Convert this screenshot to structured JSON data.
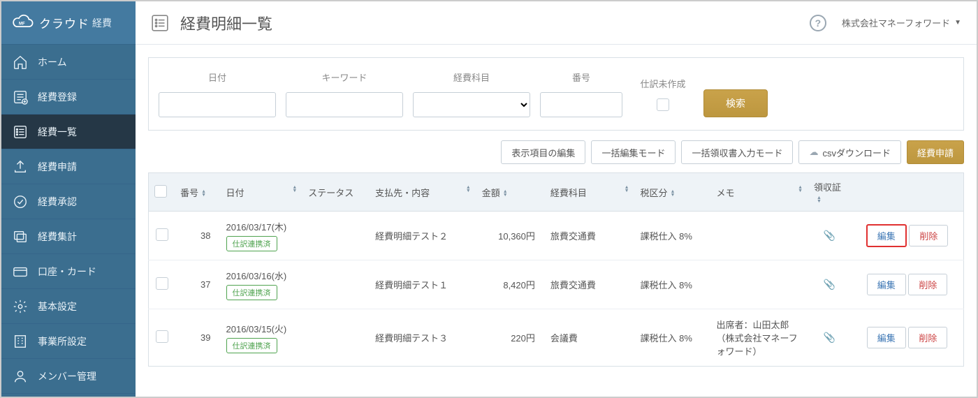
{
  "brand": {
    "name": "クラウド",
    "sub": "経費"
  },
  "sidebar": {
    "items": [
      {
        "label": "ホーム"
      },
      {
        "label": "経費登録"
      },
      {
        "label": "経費一覧"
      },
      {
        "label": "経費申請"
      },
      {
        "label": "経費承認"
      },
      {
        "label": "経費集計"
      },
      {
        "label": "口座・カード"
      },
      {
        "label": "基本設定"
      },
      {
        "label": "事業所設定"
      },
      {
        "label": "メンバー管理"
      }
    ]
  },
  "header": {
    "title": "経費明細一覧",
    "company": "株式会社マネーフォワード"
  },
  "filters": {
    "date": "日付",
    "keyword": "キーワード",
    "subject": "経費科目",
    "number": "番号",
    "unjournaled": "仕訳未作成",
    "search": "検索"
  },
  "toolbar": {
    "columns": "表示項目の編集",
    "bulk_edit": "一括編集モード",
    "bulk_receipt": "一括領収書入力モード",
    "csv": "csvダウンロード",
    "apply": "経費申請"
  },
  "table": {
    "headers": {
      "number": "番号",
      "date": "日付",
      "status": "ステータス",
      "payee": "支払先・内容",
      "amount": "金額",
      "subject": "経費科目",
      "tax": "税区分",
      "memo": "メモ",
      "receipt": "領収証"
    },
    "status_badge": "仕訳連携済",
    "edit": "編集",
    "delete": "削除",
    "rows": [
      {
        "num": "38",
        "date": "2016/03/17(木)",
        "payee": "経費明細テスト２",
        "amount": "10,360円",
        "subject": "旅費交通費",
        "tax": "課税仕入 8%",
        "memo": ""
      },
      {
        "num": "37",
        "date": "2016/03/16(水)",
        "payee": "経費明細テスト１",
        "amount": "8,420円",
        "subject": "旅費交通費",
        "tax": "課税仕入 8%",
        "memo": ""
      },
      {
        "num": "39",
        "date": "2016/03/15(火)",
        "payee": "経費明細テスト３",
        "amount": "220円",
        "subject": "会議費",
        "tax": "課税仕入 8%",
        "memo": "出席者：山田太郎（株式会社マネーフォワード）"
      }
    ]
  }
}
